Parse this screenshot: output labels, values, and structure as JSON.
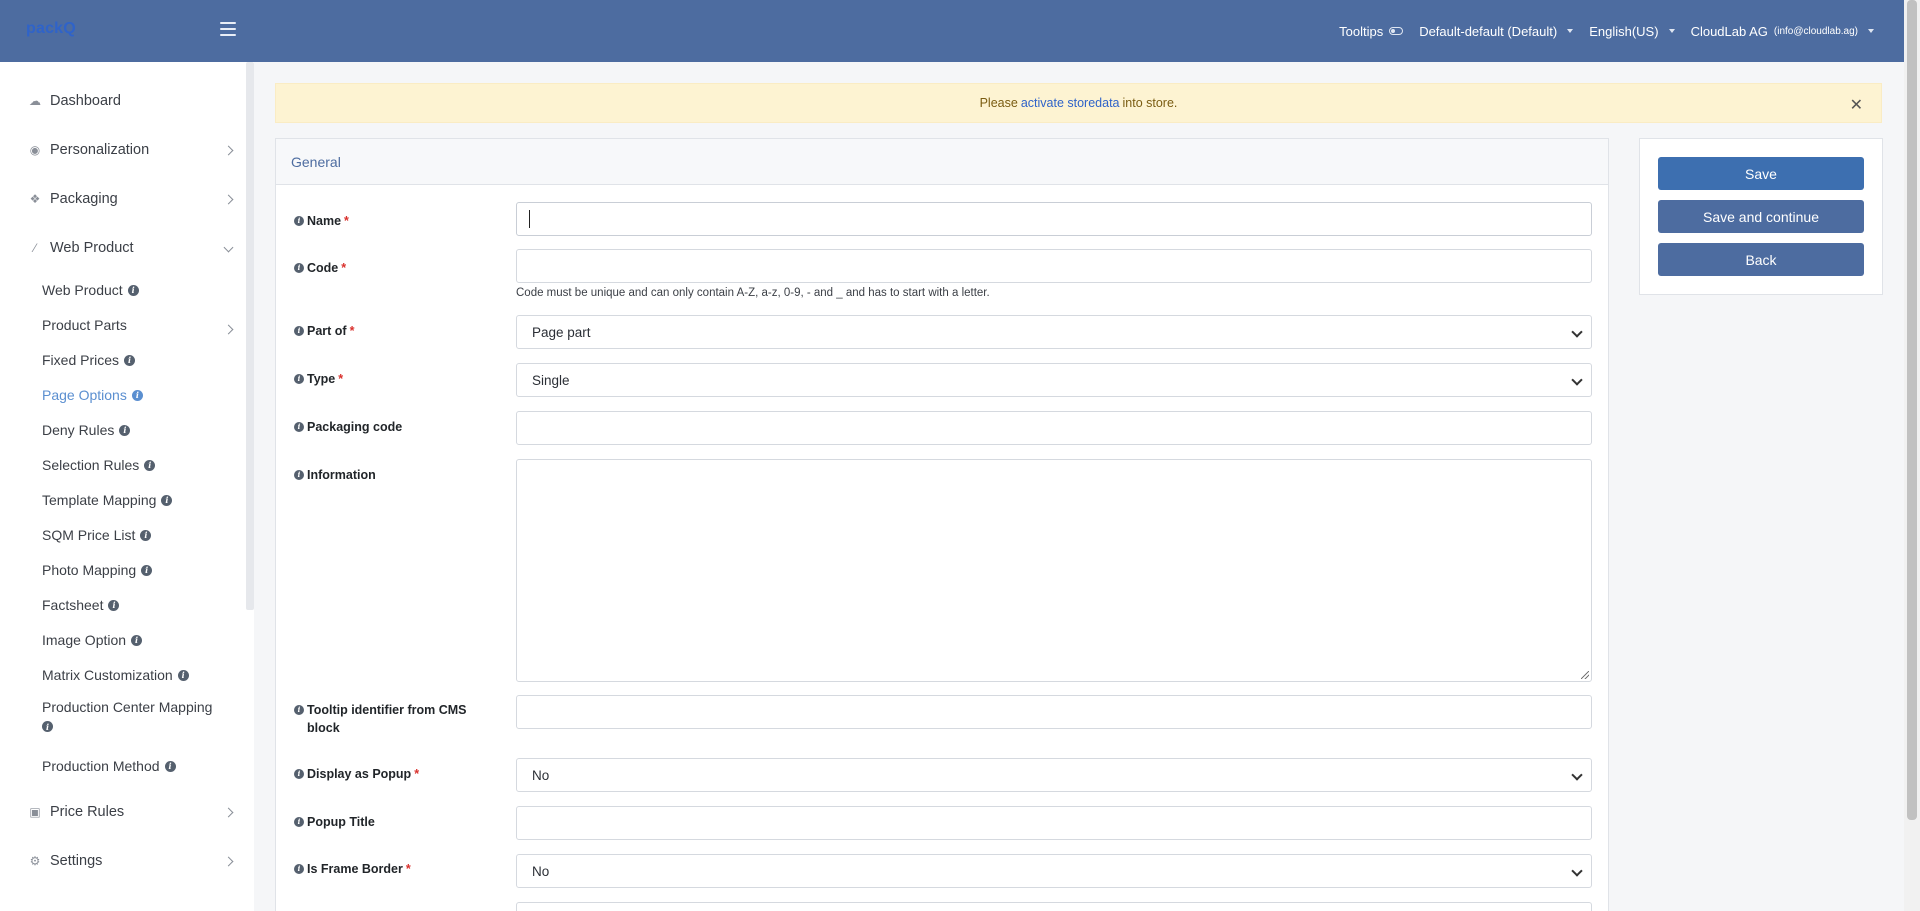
{
  "app": {
    "logo": "packQ"
  },
  "topbar": {
    "tooltips_label": "Tooltips",
    "store_view": "Default-default (Default)",
    "language": "English(US)",
    "user_name": "CloudLab AG",
    "user_email": "(info@cloudlab.ag)"
  },
  "sidebar": {
    "sections": [
      {
        "label": "Dashboard",
        "icon": "cloud-icon"
      },
      {
        "label": "Personalization",
        "icon": "eye-icon"
      },
      {
        "label": "Packaging",
        "icon": "dropbox-icon"
      },
      {
        "label": "Web Product",
        "icon": "magic-wand-icon"
      },
      {
        "label": "Price Rules",
        "icon": "money-icon"
      },
      {
        "label": "Settings",
        "icon": "cogs-icon"
      }
    ],
    "sub_items": [
      {
        "label": "Web Product"
      },
      {
        "label": "Product Parts"
      },
      {
        "label": "Fixed Prices"
      },
      {
        "label": "Page Options"
      },
      {
        "label": "Deny Rules"
      },
      {
        "label": "Selection Rules"
      },
      {
        "label": "Template Mapping"
      },
      {
        "label": "SQM Price List"
      },
      {
        "label": "Photo Mapping"
      },
      {
        "label": "Factsheet"
      },
      {
        "label": "Image Option"
      },
      {
        "label": "Matrix Customization"
      },
      {
        "label": "Production Center Mapping"
      },
      {
        "label": "Production Method"
      }
    ]
  },
  "alert": {
    "prefix": "Please",
    "link": "activate storedata",
    "suffix": "into store."
  },
  "form": {
    "section_title": "General",
    "fields": {
      "name": {
        "label": "Name",
        "value": ""
      },
      "code": {
        "label": "Code",
        "value": "",
        "help": "Code must be unique and can only contain A-Z, a-z, 0-9, - and _ and has to start with a letter."
      },
      "part_of": {
        "label": "Part of",
        "value": "Page part"
      },
      "type": {
        "label": "Type",
        "value": "Single"
      },
      "packaging_code": {
        "label": "Packaging code",
        "value": ""
      },
      "information": {
        "label": "Information",
        "value": ""
      },
      "tooltip_identifier": {
        "label": "Tooltip identifier from CMS block",
        "value": ""
      },
      "display_as_popup": {
        "label": "Display as Popup",
        "value": "No"
      },
      "popup_title": {
        "label": "Popup Title",
        "value": ""
      },
      "is_frame_border": {
        "label": "Is Frame Border",
        "value": "No"
      }
    }
  },
  "actions": {
    "save": "Save",
    "save_continue": "Save and continue",
    "back": "Back"
  },
  "colors": {
    "topbar": "#4d6ca0",
    "primary_button": "#3d6fb0",
    "active_link": "#5b8fd0",
    "alert_bg": "#fdf3d2",
    "required": "#d9302c"
  }
}
